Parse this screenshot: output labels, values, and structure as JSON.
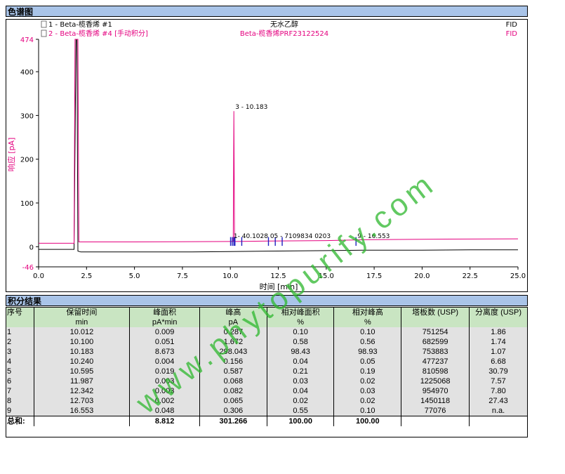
{
  "chromatogram_header": "色谱图",
  "results_header": "积分结果",
  "traces": [
    {
      "index_label": "1 - Beta-榄香烯 #1",
      "sample": "无水乙醇",
      "detector": "FID",
      "color": "#000000"
    },
    {
      "index_label": "2 - Beta-榄香烯 #4 [手动积分]",
      "sample": "Beta-榄香烯PRF23122524",
      "detector": "FID",
      "color": "#e4007f"
    }
  ],
  "colors": {
    "trace1": "#000000",
    "trace2": "#e4007f",
    "marker": "#2020c0",
    "header_bg": "#a9c4e8",
    "table_head_bg": "#c9e5c2",
    "table_row_bg": "#e2e2e2"
  },
  "chart_data": {
    "type": "line",
    "xlabel": "时间 [min]",
    "ylabel": "响应 [pA]",
    "xlim": [
      0.0,
      25.0
    ],
    "ylim": [
      -46,
      474
    ],
    "x_ticks": [
      "0.0",
      "2.5",
      "5.0",
      "7.5",
      "10.0",
      "12.5",
      "15.0",
      "17.5",
      "20.0",
      "22.5",
      "25.0"
    ],
    "y_ticks": [
      {
        "value": 474,
        "label": "474"
      },
      {
        "value": 400,
        "label": "400"
      },
      {
        "value": 300,
        "label": "300"
      },
      {
        "value": 200,
        "label": "200"
      },
      {
        "value": 100,
        "label": "100"
      },
      {
        "value": 0,
        "label": "0"
      },
      {
        "value": -46,
        "label": "-46"
      }
    ],
    "series": [
      {
        "name": "1 - Beta-榄香烯 #1",
        "x": [
          0.0,
          1.85,
          1.95,
          2.0,
          2.05,
          2.2,
          2.6,
          5.0,
          8.0,
          10.0,
          12.0,
          15.0,
          17.0,
          20.0,
          22.5,
          25.0
        ],
        "y": [
          -6,
          -6,
          474,
          474,
          -10,
          -12,
          -12,
          -12,
          -12,
          -11,
          -10,
          -9,
          -8,
          -8,
          -7,
          -7
        ]
      },
      {
        "name": "2 - Beta-榄香烯 #4 [手动积分]",
        "x": [
          0.0,
          1.85,
          1.9,
          1.95,
          2.05,
          2.1,
          5.0,
          10.0,
          10.15,
          10.183,
          10.22,
          10.3,
          12.0,
          15.0,
          17.0,
          20.0,
          25.0
        ],
        "y": [
          8,
          8,
          474,
          474,
          474,
          11,
          11,
          12,
          12,
          310,
          12,
          12,
          13,
          14,
          16,
          17,
          18
        ]
      }
    ],
    "peak_markers": [
      10.012,
      10.1,
      10.183,
      10.24,
      10.595,
      11.987,
      12.342,
      12.703,
      16.553
    ],
    "annotations": [
      {
        "label": "3 - 10.183",
        "x": 10.183,
        "y": 315
      },
      {
        "label": "9 - 16.553",
        "x": 16.553,
        "y": 20
      },
      {
        "label": "1- 40.1028 05 - 7109834 0203",
        "x": 10.1,
        "y": 20
      }
    ]
  },
  "table": {
    "headers": [
      {
        "top": "序号",
        "bottom": ""
      },
      {
        "top": "保留时间",
        "bottom": "min"
      },
      {
        "top": "峰面积",
        "bottom": "pA*min"
      },
      {
        "top": "峰高",
        "bottom": "pA"
      },
      {
        "top": "相对峰面积",
        "bottom": "%"
      },
      {
        "top": "相对峰高",
        "bottom": "%"
      },
      {
        "top": "塔板数 (USP)",
        "bottom": ""
      },
      {
        "top": "分离度 (USP)",
        "bottom": ""
      }
    ],
    "rows": [
      [
        "1",
        "10.012",
        "0.009",
        "0.287",
        "0.10",
        "0.10",
        "751254",
        "1.86"
      ],
      [
        "2",
        "10.100",
        "0.051",
        "1.672",
        "0.58",
        "0.56",
        "682599",
        "1.74"
      ],
      [
        "3",
        "10.183",
        "8.673",
        "298.043",
        "98.43",
        "98.93",
        "753883",
        "1.07"
      ],
      [
        "4",
        "10.240",
        "0.004",
        "0.156",
        "0.04",
        "0.05",
        "477237",
        "6.68"
      ],
      [
        "5",
        "10.595",
        "0.019",
        "0.587",
        "0.21",
        "0.19",
        "810598",
        "30.79"
      ],
      [
        "6",
        "11.987",
        "0.003",
        "0.068",
        "0.03",
        "0.02",
        "1225068",
        "7.57"
      ],
      [
        "7",
        "12.342",
        "0.003",
        "0.082",
        "0.04",
        "0.03",
        "954970",
        "7.80"
      ],
      [
        "8",
        "12.703",
        "0.002",
        "0.065",
        "0.02",
        "0.02",
        "1450118",
        "27.43"
      ],
      [
        "9",
        "16.553",
        "0.048",
        "0.306",
        "0.55",
        "0.10",
        "77076",
        "n.a."
      ]
    ],
    "sum_row": [
      "总和:",
      "",
      "8.812",
      "301.266",
      "100.00",
      "100.00",
      "",
      ""
    ]
  },
  "watermark": "www.phytopurify.com"
}
